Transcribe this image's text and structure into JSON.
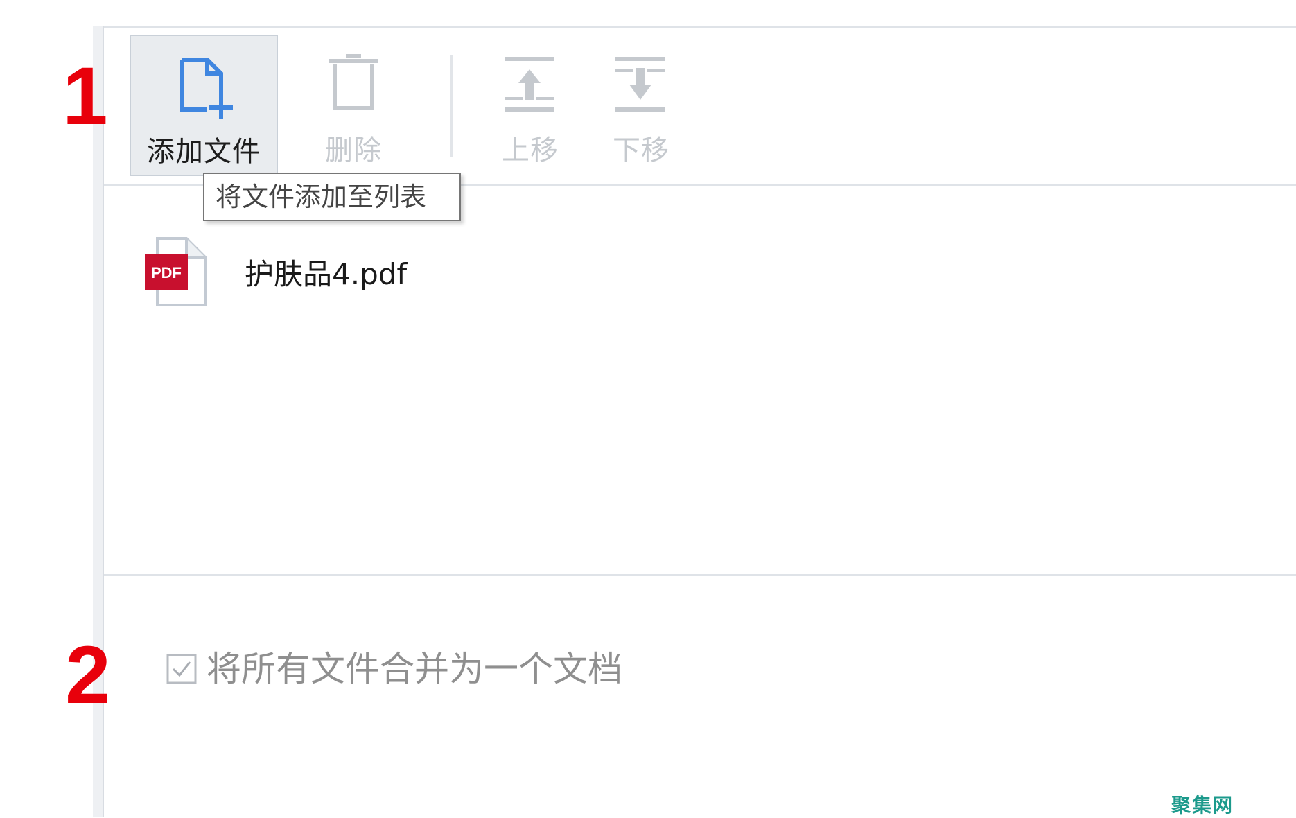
{
  "toolbar": {
    "add_file_label": "添加文件",
    "delete_label": "删除",
    "move_up_label": "上移",
    "move_down_label": "下移"
  },
  "tooltip": {
    "text": "将文件添加至列表"
  },
  "file_list": {
    "items": [
      {
        "name": "护肤品4.pdf",
        "icon": "pdf-file-icon",
        "badge": "PDF"
      }
    ]
  },
  "options": {
    "merge_label": "将所有文件合并为一个文档",
    "merge_checked": true
  },
  "annotations": {
    "marker_1": "1",
    "marker_2": "2"
  },
  "watermark": "聚集网",
  "colors": {
    "accent": "#3f86e0",
    "annotation_red": "#e8000b",
    "pdf_red": "#c8102e",
    "disabled_gray": "#c5c9ce",
    "watermark": "#1c9a8c"
  }
}
